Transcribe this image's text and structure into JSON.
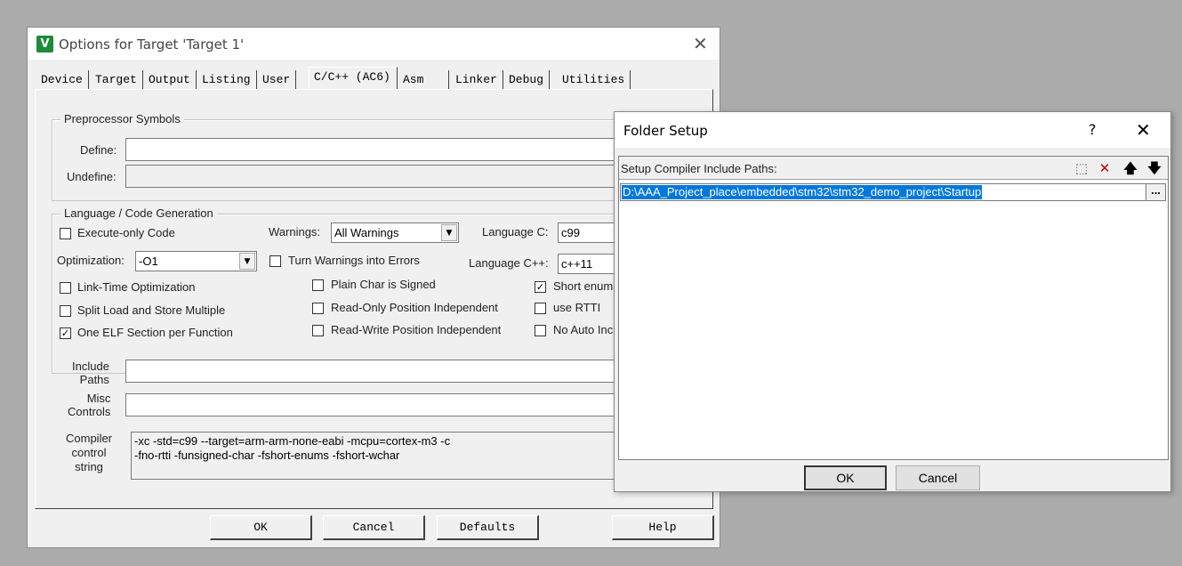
{
  "options_window": {
    "title": "Options for Target 'Target 1'",
    "app_icon_glyph": "V",
    "close_glyph": "✕",
    "tabs": [
      {
        "label": "Device"
      },
      {
        "label": "Target"
      },
      {
        "label": "Output"
      },
      {
        "label": "Listing"
      },
      {
        "label": "User"
      },
      {
        "label": "C/C++ (AC6)",
        "active": true
      },
      {
        "label": "Asm"
      },
      {
        "label": "Linker"
      },
      {
        "label": "Debug"
      },
      {
        "label": "Utilities"
      }
    ],
    "preprocessor": {
      "group_label": "Preprocessor Symbols",
      "define_label": "Define:",
      "define_value": "",
      "undefine_label": "Undefine:",
      "undefine_value": ""
    },
    "language": {
      "group_label": "Language / Code Generation",
      "execute_only_label": "Execute-only Code",
      "execute_only_checked": false,
      "warnings_label": "Warnings:",
      "warnings_value": "All Warnings",
      "language_c_label": "Language C:",
      "language_c_value": "c99",
      "optimization_label": "Optimization:",
      "optimization_value": "-O1",
      "turn_warnings_label": "Turn Warnings into Errors",
      "turn_warnings_checked": false,
      "language_cpp_label": "Language C++:",
      "language_cpp_value": "c++11",
      "lto_label": "Link-Time Optimization",
      "lto_checked": false,
      "plain_char_label": "Plain Char is Signed",
      "plain_char_checked": false,
      "short_enums_label": "Short enums",
      "short_enums_checked": true,
      "split_load_label": "Split Load and Store Multiple",
      "split_load_checked": false,
      "ropi_label": "Read-Only Position Independent",
      "ropi_checked": false,
      "rtti_label": "use RTTI",
      "rtti_checked": false,
      "one_elf_label": "One ELF Section per Function",
      "one_elf_checked": true,
      "rwpi_label": "Read-Write Position Independent",
      "rwpi_checked": false,
      "no_auto_label": "No Auto Inc",
      "no_auto_checked": false
    },
    "include_paths_label_1": "Include",
    "include_paths_label_2": "Paths",
    "include_paths_value": "",
    "misc_label_1": "Misc",
    "misc_label_2": "Controls",
    "misc_value": "",
    "compiler_label_1": "Compiler",
    "compiler_label_2": "control",
    "compiler_label_3": "string",
    "compiler_line_1": "-xc -std=c99 --target=arm-arm-none-eabi -mcpu=cortex-m3 -c",
    "compiler_line_2": "-fno-rtti -funsigned-char -fshort-enums -fshort-wchar",
    "buttons": {
      "ok": "OK",
      "cancel": "Cancel",
      "defaults": "Defaults",
      "help": "Help"
    }
  },
  "folder_setup": {
    "title": "Folder Setup",
    "help_glyph": "?",
    "close_glyph": "✕",
    "list_header": "Setup Compiler Include Paths:",
    "tools": {
      "new_icon": "new-folder-icon",
      "delete_icon": "delete-icon",
      "up_icon": "move-up-icon",
      "down_icon": "move-down-icon"
    },
    "tool_glyphs": {
      "new": "⬚",
      "delete": "✕",
      "up": "🡅",
      "down": "🡇"
    },
    "paths": [
      "D:\\AAA_Project_place\\embedded\\stm32\\stm32_demo_project\\Startup"
    ],
    "browse_label": "...",
    "ok_label": "OK",
    "cancel_label": "Cancel",
    "colors": {
      "selection": "#0078d7",
      "delete": "#c00000"
    }
  }
}
